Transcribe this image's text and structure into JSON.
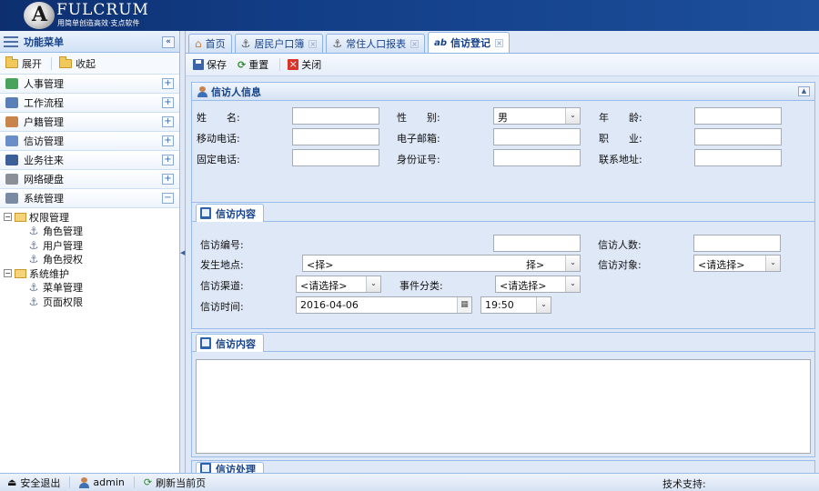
{
  "header": {
    "brand": "FULCRUM",
    "logo_letter": "A",
    "slogan": "用简单创造高效·支点软件"
  },
  "sidebar": {
    "title": "功能菜单",
    "collapse": "«",
    "expand_label": "展开",
    "collapse_label": "收起",
    "menus": [
      {
        "label": "人事管理",
        "toggle": "+",
        "color": "#4aa35a"
      },
      {
        "label": "工作流程",
        "toggle": "+",
        "color": "#5a7fb6"
      },
      {
        "label": "户籍管理",
        "toggle": "+",
        "color": "#c9844c"
      },
      {
        "label": "信访管理",
        "toggle": "+",
        "color": "#6a8fc8"
      },
      {
        "label": "业务往来",
        "toggle": "+",
        "color": "#3d5f97"
      },
      {
        "label": "网络硬盘",
        "toggle": "+",
        "color": "#8a8f98"
      },
      {
        "label": "系统管理",
        "toggle": "−",
        "color": "#7b8aa3"
      }
    ],
    "tree": [
      {
        "label": "权限管理",
        "level": 0,
        "toggle": "−"
      },
      {
        "label": "角色管理",
        "level": 1
      },
      {
        "label": "用户管理",
        "level": 1
      },
      {
        "label": "角色授权",
        "level": 1
      },
      {
        "label": "系统维护",
        "level": 0,
        "toggle": "−"
      },
      {
        "label": "菜单管理",
        "level": 1
      },
      {
        "label": "页面权限",
        "level": 1
      }
    ]
  },
  "tabs": [
    {
      "label": "首页",
      "icon": "home-icon",
      "closable": false,
      "active": false
    },
    {
      "label": "居民户口簿",
      "icon": "anchor-icon",
      "closable": true,
      "active": false
    },
    {
      "label": "常住人口报表",
      "icon": "anchor-icon",
      "closable": true,
      "active": false
    },
    {
      "label": "信访登记",
      "icon": "ab-icon",
      "closable": true,
      "active": true
    }
  ],
  "tab_glyphs": {
    "home": "⌂",
    "anchor": "⚓",
    "ab": "ab",
    "close": "×"
  },
  "toolbar": {
    "save": "保存",
    "reset": "重置",
    "close": "关闭",
    "close_glyph": "×",
    "reset_glyph": "⟳"
  },
  "visitor_panel": {
    "title": "信访人信息",
    "collapse": "▲",
    "fields": {
      "name": "姓　　名:",
      "gender": "性　　别:",
      "age": "年　　龄:",
      "mobile": "移动电话:",
      "email": "电子邮箱:",
      "job": "职　　业:",
      "phone": "固定电话:",
      "idcard": "身份证号:",
      "address": "联系地址:"
    },
    "gender_value": "男"
  },
  "content_panel": {
    "title": "信访内容",
    "fields": {
      "number": "信访编号:",
      "count": "信访人数:",
      "place": "发生地点:",
      "target": "信访对象:",
      "channel": "信访渠道:",
      "category": "事件分类:",
      "time": "信访时间:"
    },
    "place_value_left": "<择>",
    "place_value_right": "择>",
    "target_value": "<请选择>",
    "channel_value": "<请选择>",
    "category_value": "<请选择>",
    "date_value": "2016-04-06",
    "time_value": "19:50"
  },
  "content_text_panel": {
    "title": "信访内容"
  },
  "handling_panel": {
    "title": "信访处理"
  },
  "arrow_glyph": "⌄",
  "status": {
    "logout": "安全退出",
    "user": "admin",
    "refresh": "刷新当前页",
    "support": "技术支持:"
  }
}
